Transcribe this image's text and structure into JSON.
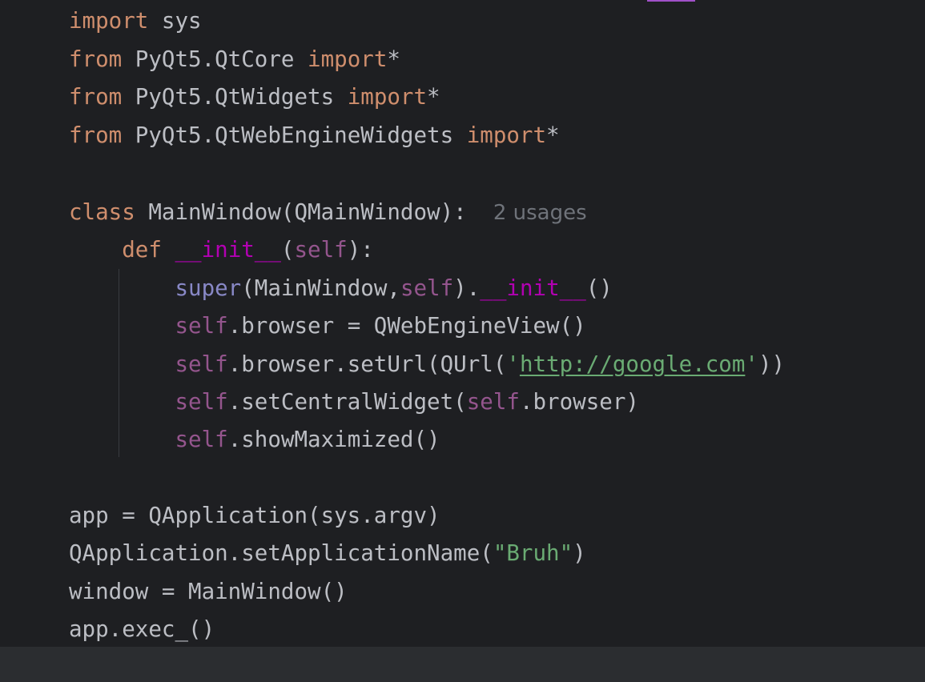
{
  "editor": {
    "lines": {
      "l1": {
        "kw": "import",
        "rest": " sys"
      },
      "l2": {
        "kw": "from",
        "mid": " PyQt5.QtCore ",
        "kw2": "import",
        "rest": "*"
      },
      "l3": {
        "kw": "from",
        "mid": " PyQt5.QtWidgets ",
        "kw2": "import",
        "rest": "*"
      },
      "l4": {
        "kw": "from",
        "mid": " PyQt5.QtWebEngineWidgets ",
        "kw2": "import",
        "rest": "*"
      },
      "l5": {
        "kw": "class",
        "rest": " MainWindow(QMainWindow):",
        "hint": "2 usages"
      },
      "l6": {
        "indent": "    ",
        "kw": "def",
        "sp": " ",
        "dunder": "__init__",
        "p1": "(",
        "self": "self",
        "p2": "):"
      },
      "l7": {
        "indent": "        ",
        "builtin": "super",
        "p1": "(MainWindow,",
        "self": "self",
        "p2": ").",
        "dunder": "__init__",
        "p3": "()"
      },
      "l8": {
        "indent": "        ",
        "self": "self",
        "rest": ".browser = QWebEngineView()"
      },
      "l9": {
        "indent": "        ",
        "self": "self",
        "rest": ".browser.setUrl(QUrl(",
        "q1": "'",
        "url": "http://google.com",
        "q2": "'",
        "end": "))"
      },
      "l10": {
        "indent": "        ",
        "self": "self",
        "rest": ".setCentralWidget(",
        "self2": "self",
        "end": ".browser)"
      },
      "l11": {
        "indent": "        ",
        "self": "self",
        "rest": ".showMaximized()"
      },
      "l12": {
        "text": "app = QApplication(sys.argv)"
      },
      "l13": {
        "pre": "QApplication.setApplicationName(",
        "str": "\"Bruh\"",
        "end": ")"
      },
      "l14": {
        "text": "window = MainWindow()"
      },
      "l15": {
        "text": "app.exec_()"
      }
    }
  },
  "colors": {
    "background": "#1e1f22",
    "keyword": "#cf8e6d",
    "self": "#94558d",
    "dunder": "#b200b2",
    "builtin": "#8888c6",
    "string": "#6aab73",
    "text": "#bcbec4",
    "hint": "#6f737a"
  }
}
